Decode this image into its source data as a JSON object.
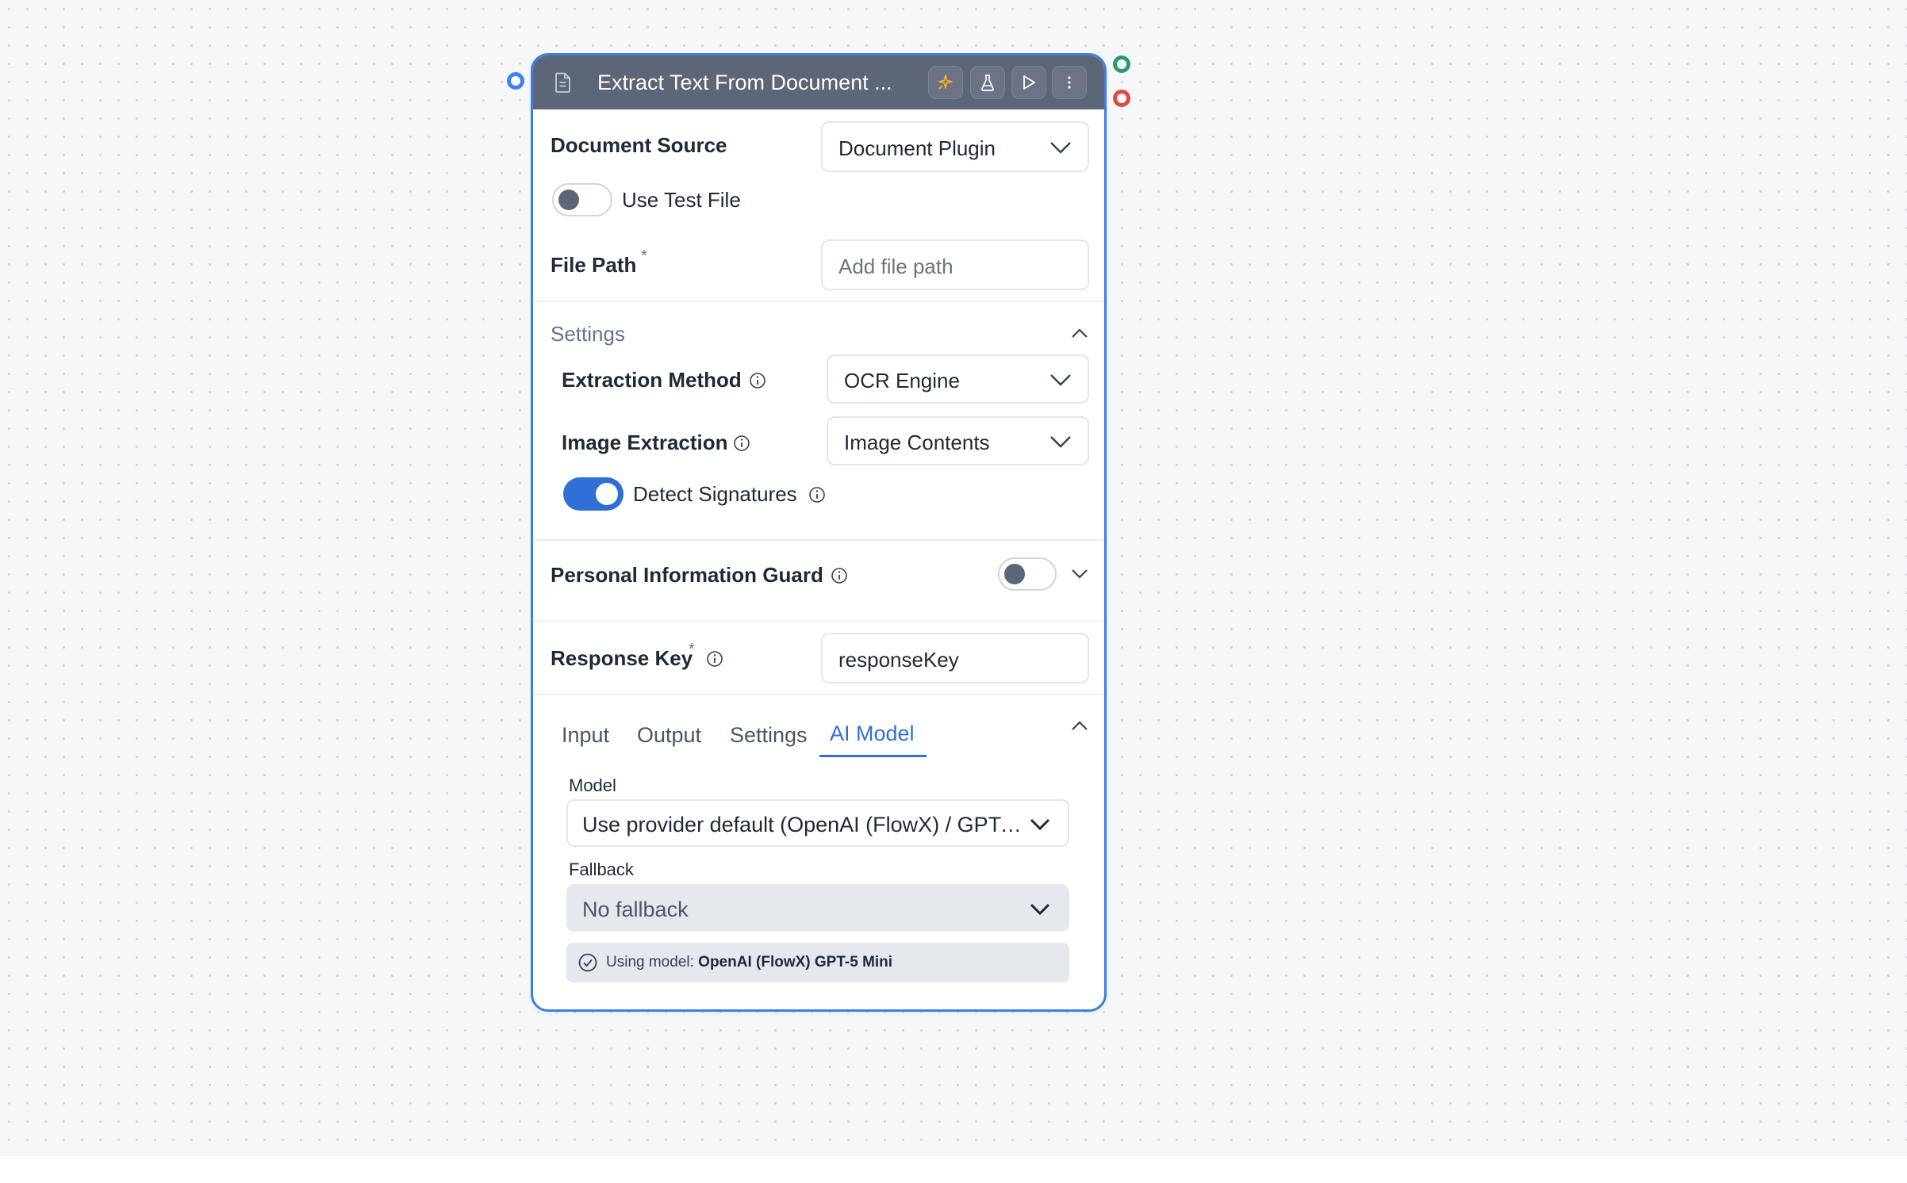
{
  "node": {
    "title": "Extract Text From Document ...",
    "header_buttons": [
      "magic-wand-icon",
      "flask-icon",
      "play-icon",
      "more-vertical-icon"
    ]
  },
  "document_source": {
    "label": "Document Source",
    "value": "Document Plugin"
  },
  "use_test_file": {
    "label": "Use Test File",
    "enabled": false
  },
  "file_path": {
    "label": "File Path",
    "required_mark": "*",
    "placeholder": "Add file path",
    "value": ""
  },
  "settings": {
    "title": "Settings",
    "expanded": true,
    "extraction_method": {
      "label": "Extraction Method",
      "value": "OCR Engine"
    },
    "image_extraction": {
      "label": "Image Extraction",
      "value": "Image Contents"
    },
    "detect_signatures": {
      "label": "Detect Signatures",
      "enabled": true
    }
  },
  "pii_guard": {
    "label": "Personal Information Guard",
    "enabled": false
  },
  "response_key": {
    "label": "Response Key",
    "required_mark": "*",
    "value": "responseKey"
  },
  "tabs": {
    "items": [
      "Input",
      "Output",
      "Settings",
      "AI Model"
    ],
    "active": "AI Model"
  },
  "ai_model": {
    "model_label": "Model",
    "model_value": "Use provider default (OpenAI (FlowX) / GPT-...",
    "fallback_label": "Fallback",
    "fallback_value": "No fallback",
    "using_prefix": "Using model: ",
    "using_model": "OpenAI (FlowX) GPT-5 Mini"
  },
  "colors": {
    "accent": "#2f6fd6",
    "header_bg": "#5d6676",
    "handle_input": "#3b82f6",
    "handle_success": "#2f9a72",
    "handle_error": "#dc4a3d"
  }
}
